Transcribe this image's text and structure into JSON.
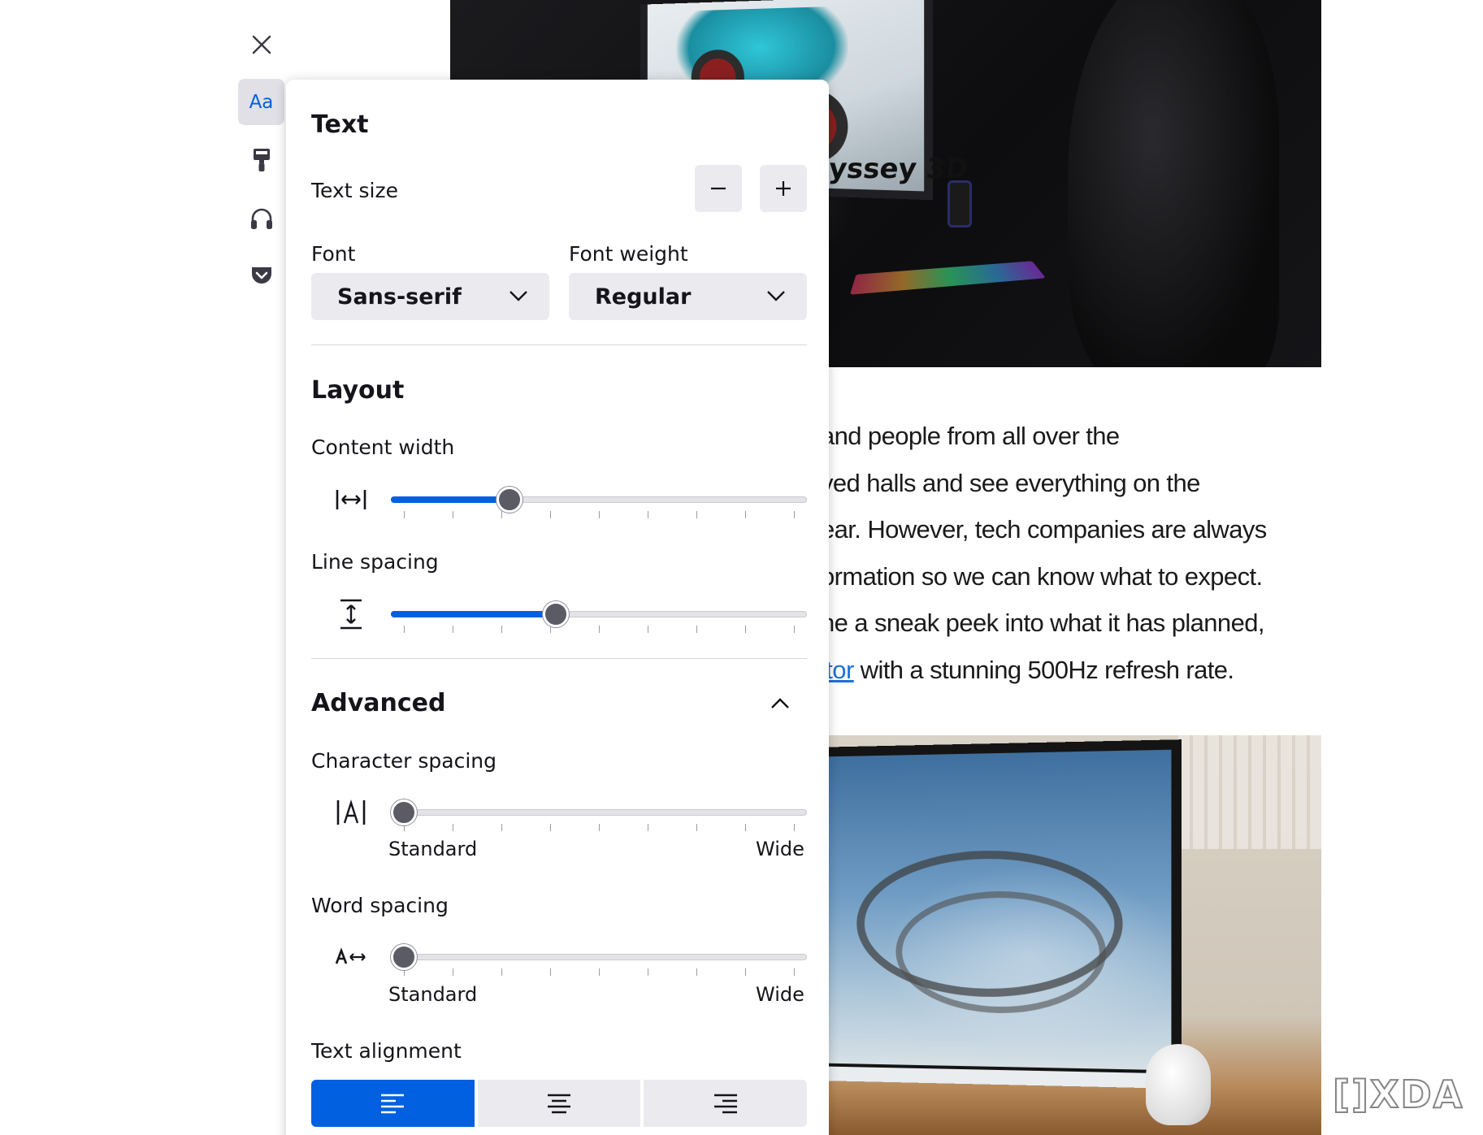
{
  "toolbar": {
    "items": [
      {
        "name": "close",
        "icon": "close-icon"
      },
      {
        "name": "text-and-layout",
        "icon": "aa-icon",
        "label": "Aa",
        "active": true
      },
      {
        "name": "theme",
        "icon": "paintbrush-icon"
      },
      {
        "name": "read-aloud",
        "icon": "headphones-icon"
      },
      {
        "name": "pocket",
        "icon": "pocket-icon"
      }
    ]
  },
  "panel": {
    "text_section": {
      "title": "Text",
      "text_size_label": "Text size",
      "decrease_icon": "minus-icon",
      "increase_icon": "plus-icon",
      "font_label": "Font",
      "font_value": "Sans-serif",
      "weight_label": "Font weight",
      "weight_value": "Regular"
    },
    "layout_section": {
      "title": "Layout",
      "content_width_label": "Content width",
      "content_width_value": 0.27,
      "line_spacing_label": "Line spacing",
      "line_spacing_value": 0.39
    },
    "advanced_section": {
      "title": "Advanced",
      "expanded": true,
      "character_spacing_label": "Character spacing",
      "character_spacing_value": 0,
      "word_spacing_label": "Word spacing",
      "word_spacing_value": 0,
      "min_label": "Standard",
      "max_label": "Wide",
      "text_alignment_label": "Text alignment",
      "alignment_options": [
        "align-left-icon",
        "align-center-icon",
        "align-right-icon"
      ],
      "alignment_selected": 0
    }
  },
  "article": {
    "lines": [
      "and people from all over the",
      "ved halls and see everything on the",
      "ear. However, tech companies are always",
      "ormation so we can know what to expect.",
      "ne a sneak peek into what it has planned,"
    ],
    "last_line_link": "itor",
    "last_line_rest": " with a stunning 500Hz refresh rate."
  },
  "photo_top": {
    "brand_text": "yssey 3D"
  },
  "watermark": {
    "text": "XDA"
  },
  "colors": {
    "accent": "#0060df",
    "panel_bg": "#ffffff",
    "button_bg": "#ebebef",
    "thumb": "#5b5b66"
  }
}
